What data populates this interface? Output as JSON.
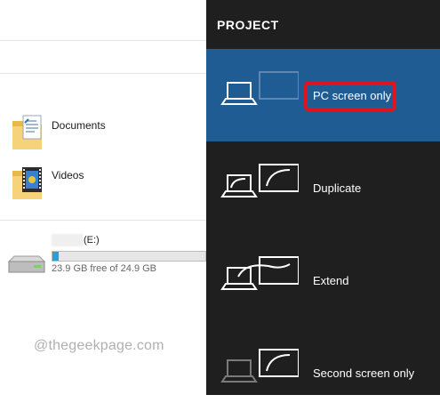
{
  "explorer": {
    "folders": [
      {
        "label": "Documents",
        "icon": "documents-folder-icon"
      },
      {
        "label": "Videos",
        "icon": "videos-folder-icon"
      }
    ],
    "drive": {
      "label": "(E:)",
      "free_text": "23.9 GB free of 24.9 GB",
      "used_fraction": 0.04,
      "icon": "drive-icon",
      "bar_color": "#26a0da"
    }
  },
  "watermark": "@thegeekpage.com",
  "project": {
    "title": "PROJECT",
    "options": [
      {
        "label": "PC screen only",
        "icon": "pc-screen-only-icon",
        "selected": true,
        "highlighted": true
      },
      {
        "label": "Duplicate",
        "icon": "duplicate-icon",
        "selected": false
      },
      {
        "label": "Extend",
        "icon": "extend-icon",
        "selected": false
      },
      {
        "label": "Second screen only",
        "icon": "second-screen-only-icon",
        "selected": false
      }
    ],
    "colors": {
      "panel": "#1f1f1f",
      "selected": "#1f5c94",
      "highlight": "#e0141e"
    }
  }
}
